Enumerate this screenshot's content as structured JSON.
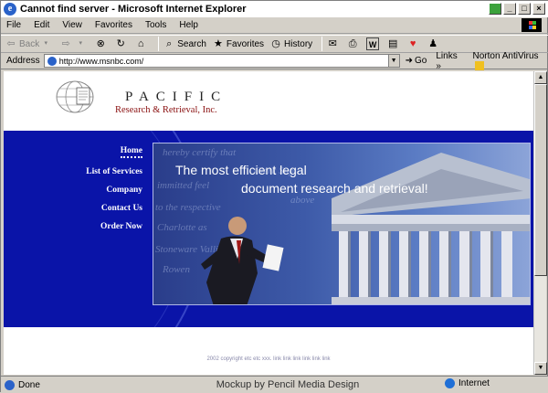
{
  "window": {
    "title": "Cannot find server - Microsoft Internet Explorer"
  },
  "menu": [
    "File",
    "Edit",
    "View",
    "Favorites",
    "Tools",
    "Help"
  ],
  "toolbar": {
    "back": "Back",
    "search": "Search",
    "favorites": "Favorites",
    "history": "History"
  },
  "address": {
    "label": "Address",
    "url": "http://www.msnbc.com/",
    "go": "Go",
    "links": "Links",
    "norton": "Norton AntiVirus"
  },
  "site": {
    "name": "PACIFIC",
    "subtitle": "Research & Retrieval, Inc.",
    "nav": [
      "Home",
      "List of Services",
      "Company",
      "Contact Us",
      "Order Now"
    ],
    "headline_line1": "The most efficient legal",
    "headline_line2": "document research and retrieval!",
    "footer": "2002 copyright etc etc xxx. link link link link link link"
  },
  "status": {
    "text": "Done",
    "credit": "Mockup by Pencil Media Design",
    "zone": "Internet"
  },
  "colors": {
    "banner": "#0a14a8",
    "accent": "#8a1010"
  }
}
